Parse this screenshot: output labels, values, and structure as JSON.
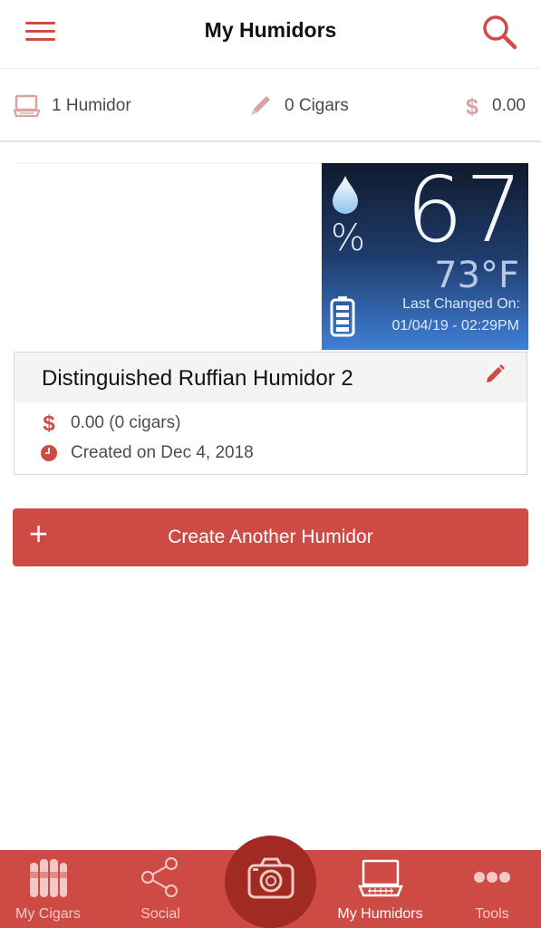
{
  "header": {
    "title": "My Humidors",
    "menu_icon": "hamburger-icon",
    "search_icon": "search-icon"
  },
  "stats": {
    "humidors": "1 Humidor",
    "cigars": "0 Cigars",
    "value": "0.00"
  },
  "humidor_card": {
    "name": "Distinguished Ruffian Humidor 2",
    "humidity": "67",
    "humidity_symbol": "%",
    "temperature": "73°F",
    "last_changed_label": "Last Changed On:",
    "last_changed_value": "01/04/19 - 02:29PM",
    "value_text": "0.00 (0 cigars)",
    "created_text": "Created on Dec 4, 2018"
  },
  "create_button": {
    "plus": "+",
    "label": "Create Another Humidor"
  },
  "tabbar": {
    "tabs": [
      {
        "label": "My Cigars",
        "icon": "cigars-icon",
        "active": false
      },
      {
        "label": "Social",
        "icon": "share-icon",
        "active": false
      },
      {
        "label": "My Humidors",
        "icon": "humidor-icon",
        "active": true
      },
      {
        "label": "Tools",
        "icon": "more-dots-icon",
        "active": false
      }
    ],
    "camera_icon": "camera-icon"
  },
  "colors": {
    "accent": "#cd4b44",
    "accent_dark": "#a12a22",
    "sensor_top": "#0f1a2c",
    "sensor_bottom": "#3f7fd6"
  }
}
